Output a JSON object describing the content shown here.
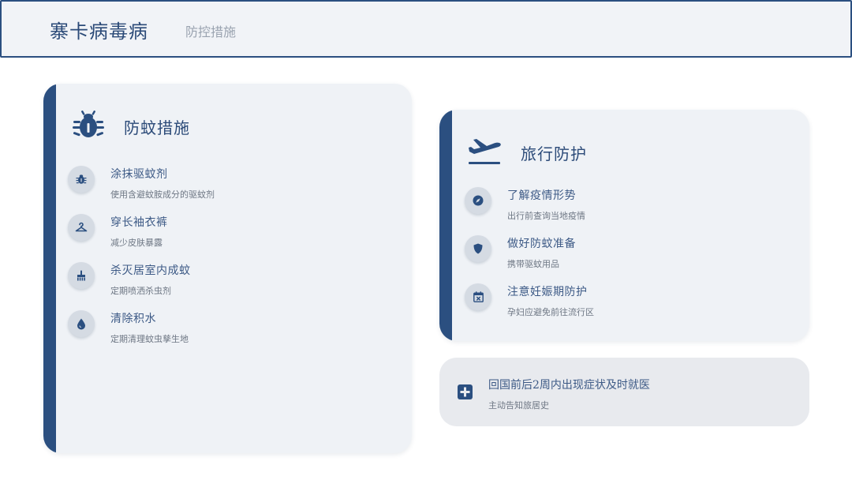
{
  "header": {
    "title": "寨卡病毒病",
    "subtitle": "防控措施"
  },
  "colors": {
    "accent": "#2b4f80",
    "card_bg": "#eff2f6",
    "text_primary": "#3d5a86",
    "text_secondary": "#6e7784"
  },
  "left_card": {
    "icon": "bug-icon",
    "title": "防蚊措施",
    "items": [
      {
        "icon": "bug-small-icon",
        "label": "涂抹驱蚊剂",
        "desc": "使用含避蚊胺成分的驱蚊剂"
      },
      {
        "icon": "hanger-icon",
        "label": "穿长袖衣裤",
        "desc": "减少皮肤暴露"
      },
      {
        "icon": "broom-icon",
        "label": "杀灭居室内成蚊",
        "desc": "定期喷洒杀虫剂"
      },
      {
        "icon": "water-drop-icon",
        "label": "清除积水",
        "desc": "定期清理蚊虫孳生地"
      }
    ]
  },
  "right_card": {
    "icon": "airplane-departure-icon",
    "title": "旅行防护",
    "items": [
      {
        "icon": "compass-icon",
        "label": "了解疫情形势",
        "desc": "出行前查询当地疫情"
      },
      {
        "icon": "shield-icon",
        "label": "做好防蚊准备",
        "desc": "携带驱蚊用品"
      },
      {
        "icon": "calendar-x-icon",
        "label": "注意妊娠期防护",
        "desc": "孕妇应避免前往流行区"
      }
    ]
  },
  "note_card": {
    "icon": "medical-plus-icon",
    "text": "回国前后2周内出现症状及时就医",
    "desc": "主动告知旅居史"
  }
}
